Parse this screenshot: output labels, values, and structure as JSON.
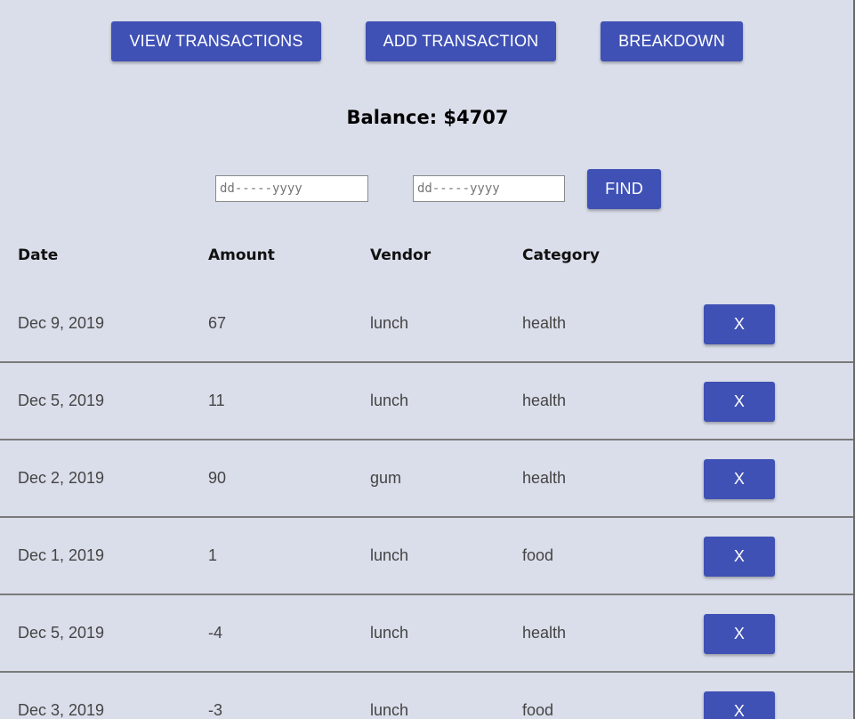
{
  "nav": {
    "view": "VIEW TRANSACTIONS",
    "add": "ADD TRANSACTION",
    "breakdown": "BREAKDOWN"
  },
  "balance": "Balance: $4707",
  "filter": {
    "from_placeholder": "dd-----yyyy",
    "to_placeholder": "dd-----yyyy",
    "find": "FIND"
  },
  "table": {
    "headers": [
      "Date",
      "Amount",
      "Vendor",
      "Category"
    ],
    "delete_label": "X",
    "rows": [
      {
        "date": "Dec 9, 2019",
        "amount": "67",
        "vendor": "lunch",
        "category": "health"
      },
      {
        "date": "Dec 5, 2019",
        "amount": "11",
        "vendor": "lunch",
        "category": "health"
      },
      {
        "date": "Dec 2, 2019",
        "amount": "90",
        "vendor": "gum",
        "category": "health"
      },
      {
        "date": "Dec 1, 2019",
        "amount": "1",
        "vendor": "lunch",
        "category": "food"
      },
      {
        "date": "Dec 5, 2019",
        "amount": "-4",
        "vendor": "lunch",
        "category": "health"
      },
      {
        "date": "Dec 3, 2019",
        "amount": "-3",
        "vendor": "lunch",
        "category": "food"
      }
    ]
  },
  "colors": {
    "accent": "#3f51b5",
    "background": "#dadeea"
  }
}
